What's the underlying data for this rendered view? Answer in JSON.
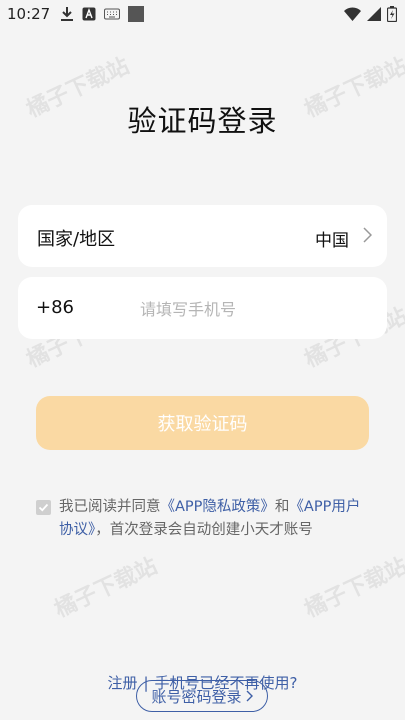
{
  "status_bar": {
    "time": "10:27",
    "icons_left": [
      "download-icon",
      "keyboard-a-icon",
      "keyboard-icon",
      "stop-square-icon"
    ],
    "icons_right": [
      "wifi-icon",
      "signal-icon",
      "battery-icon"
    ]
  },
  "watermark": "橘子下载站",
  "page": {
    "title": "验证码登录"
  },
  "region": {
    "label": "国家/地区",
    "value": "中国"
  },
  "phone": {
    "country_code": "+86",
    "placeholder": "请填写手机号",
    "value": ""
  },
  "get_code_button": "获取验证码",
  "agreement": {
    "checked": true,
    "prefix": "我已阅读并同意",
    "link1": "《APP隐私政策》",
    "and": "和",
    "link2": "《APP用户协议》",
    "suffix": "，首次登录会自动创建小天才账号"
  },
  "footer": {
    "register": "注册",
    "separator": "|",
    "phone_unavailable": "手机号已经不再使用?",
    "account_login": "账号密码登录"
  },
  "colors": {
    "accent": "#fad9a3",
    "link": "#3e5fa6",
    "background": "#f4f4f4"
  }
}
